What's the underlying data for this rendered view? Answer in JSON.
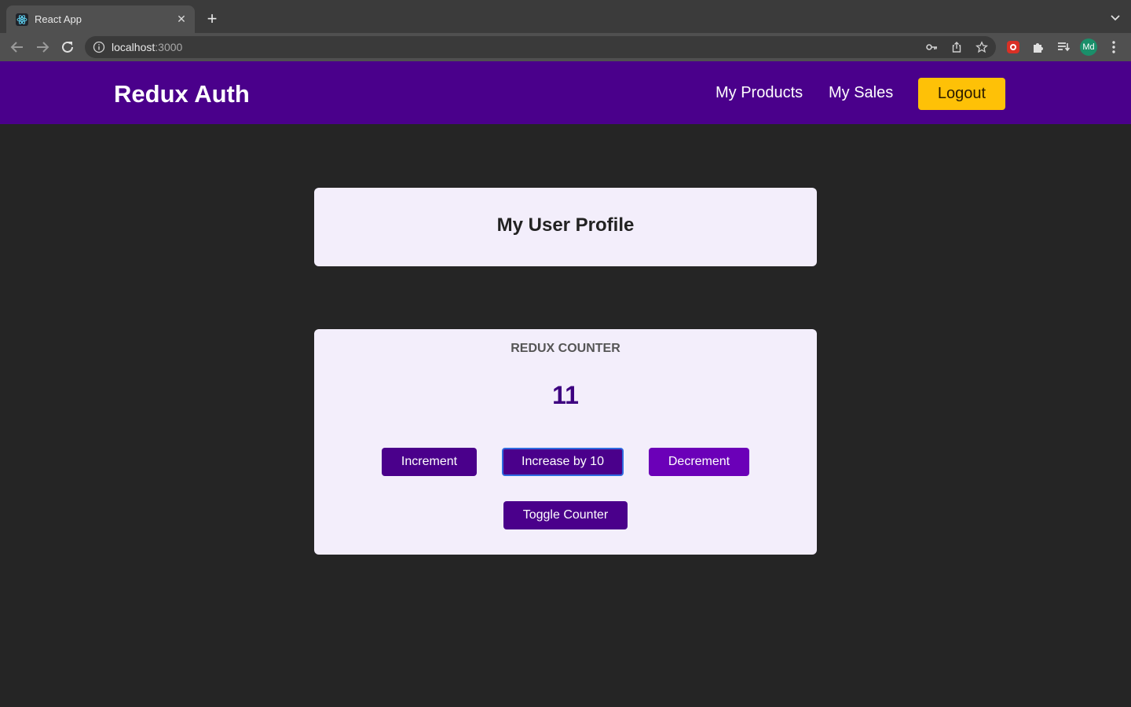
{
  "browser": {
    "tab_title": "React App",
    "url_host": "localhost",
    "url_port": ":3000",
    "avatar_initials": "Md"
  },
  "header": {
    "brand": "Redux Auth",
    "nav": [
      "My Products",
      "My Sales"
    ],
    "logout_label": "Logout"
  },
  "profile": {
    "title": "My User Profile"
  },
  "counter": {
    "title": "REDUX COUNTER",
    "value": "11",
    "buttons": {
      "increment": "Increment",
      "increase_by_10": "Increase by 10",
      "decrement": "Decrement",
      "toggle": "Toggle Counter"
    }
  },
  "colors": {
    "header_bg": "#4a008b",
    "logout_bg": "#fec107",
    "card_bg": "#f3eefb",
    "page_bg": "#252525"
  }
}
